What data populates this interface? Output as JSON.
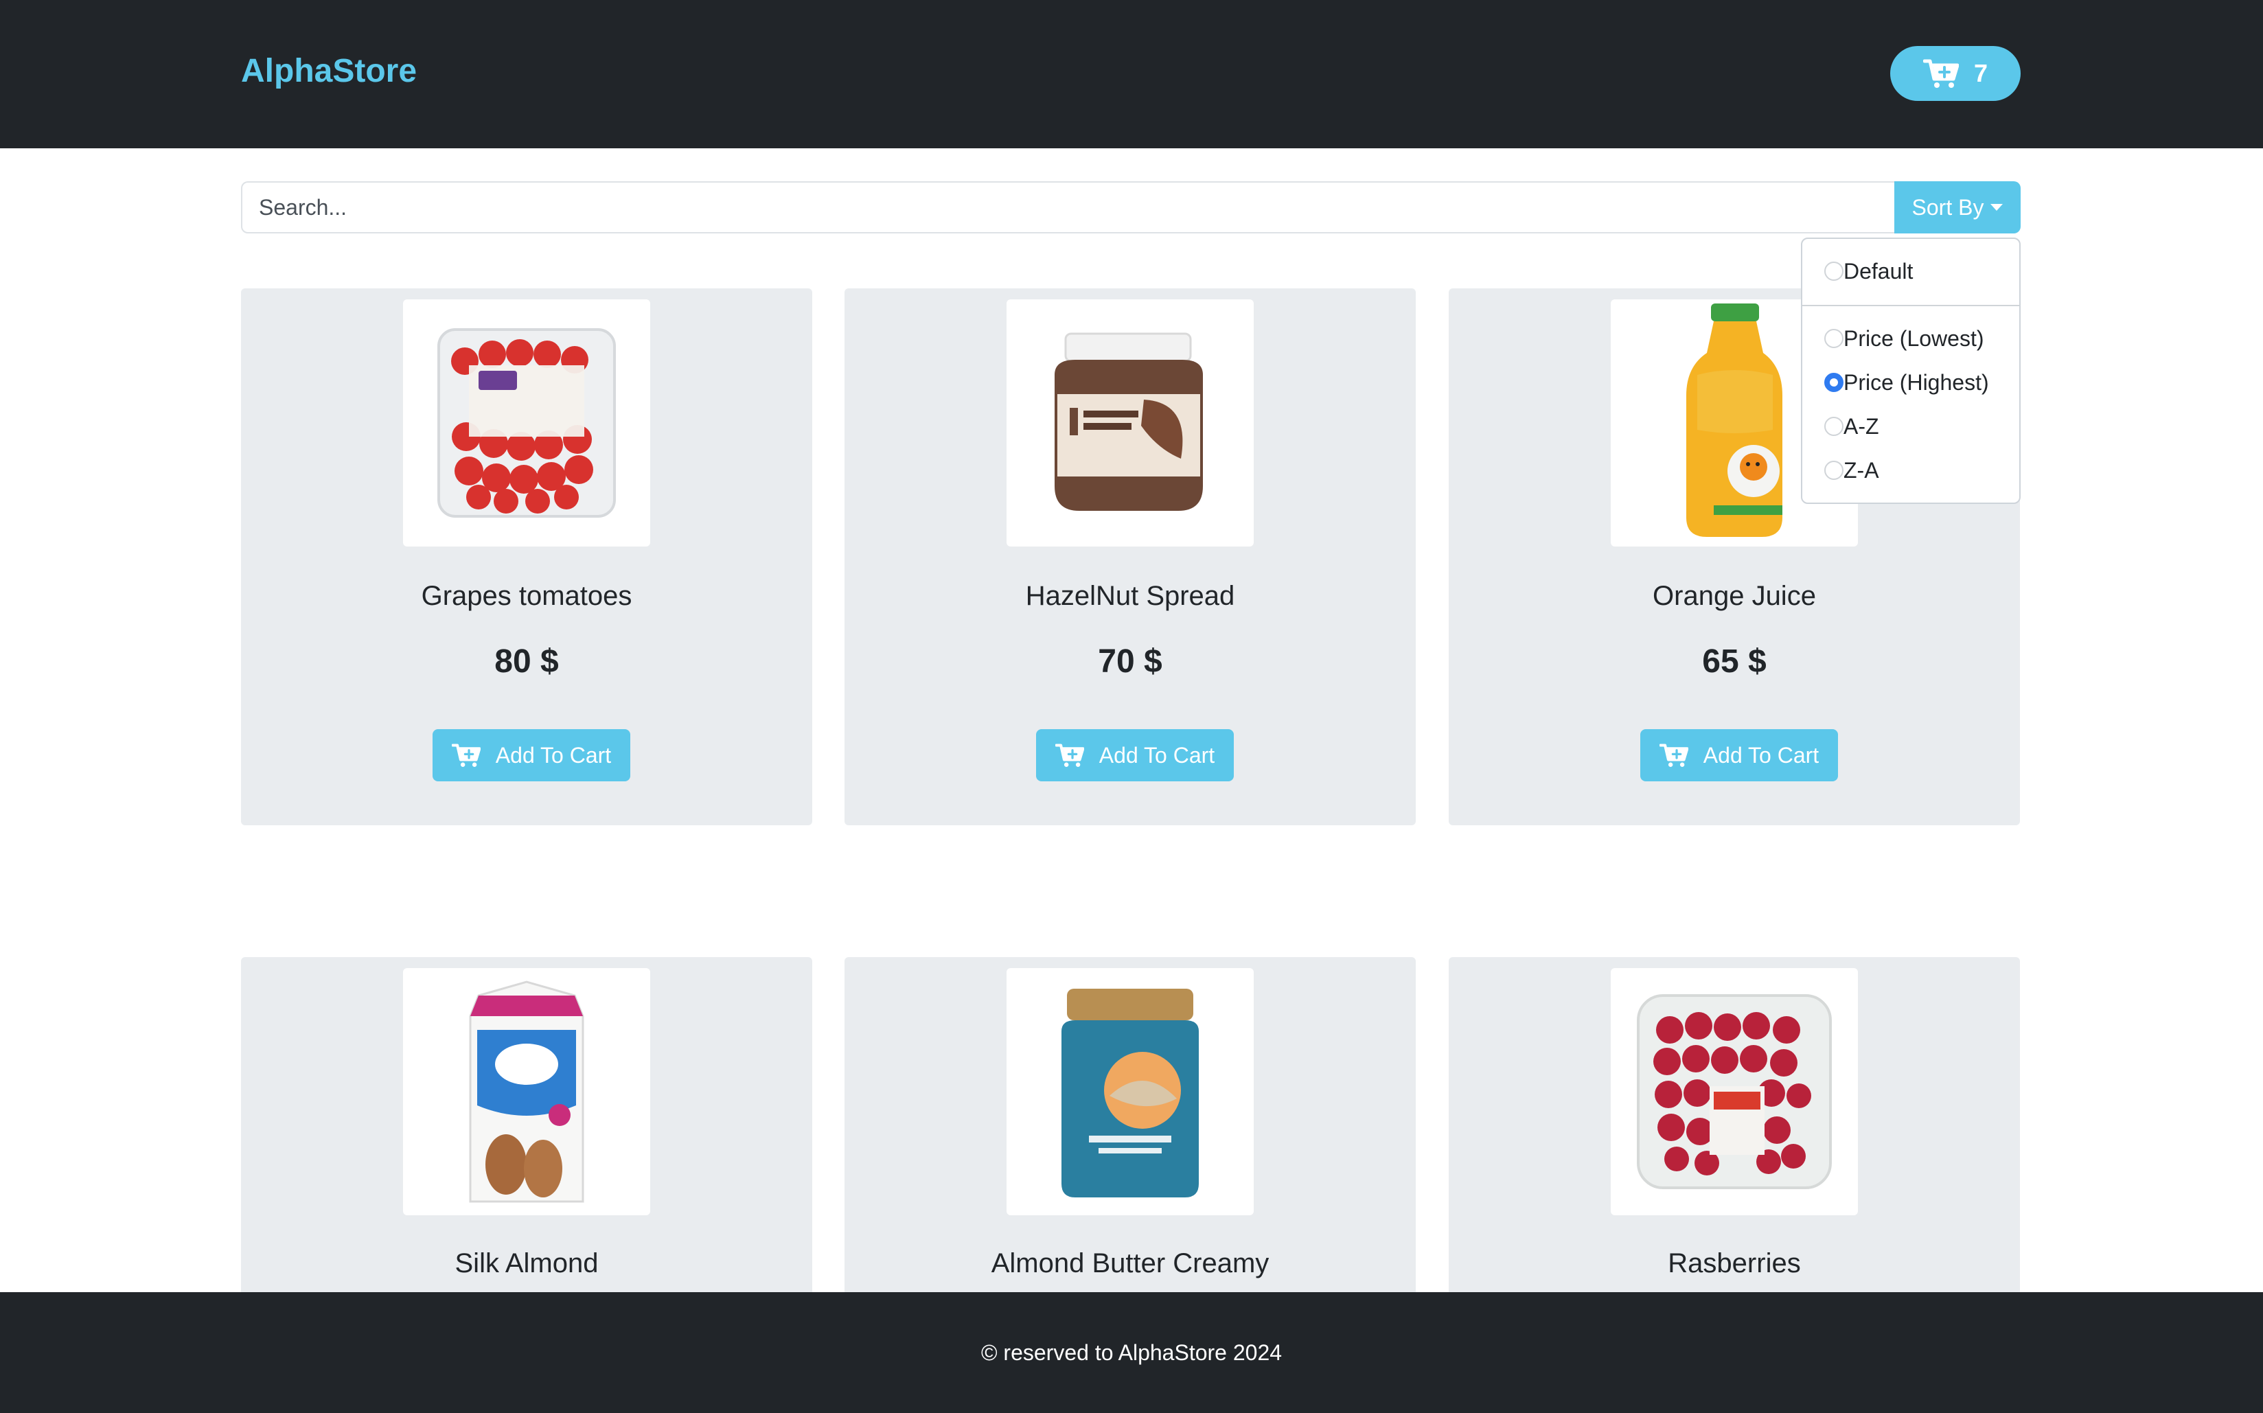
{
  "brand": "AlphaStore",
  "cart": {
    "count": "7",
    "icon": "cart-plus-icon"
  },
  "search": {
    "placeholder": "Search...",
    "value": ""
  },
  "sort": {
    "label": "Sort By",
    "options": [
      {
        "label": "Default",
        "checked": false
      },
      {
        "label": "Price (Lowest)",
        "checked": false
      },
      {
        "label": "Price (Highest)",
        "checked": true
      },
      {
        "label": "A-Z",
        "checked": false
      },
      {
        "label": "Z-A",
        "checked": false
      }
    ]
  },
  "products": [
    {
      "name": "Grapes tomatoes",
      "price": "80 $",
      "button": "Add To Cart"
    },
    {
      "name": "HazelNut Spread",
      "price": "70 $",
      "button": "Add To Cart"
    },
    {
      "name": "Orange Juice",
      "price": "65 $",
      "button": "Add To Cart"
    },
    {
      "name": "Silk Almond"
    },
    {
      "name": "Almond Butter Creamy"
    },
    {
      "name": "Rasberries"
    }
  ],
  "footer": "© reserved to AlphaStore 2024",
  "colors": {
    "accent": "#5bc7ea",
    "dark": "#212529",
    "card": "#e9ecef",
    "radio_checked": "#2f7bf0"
  }
}
